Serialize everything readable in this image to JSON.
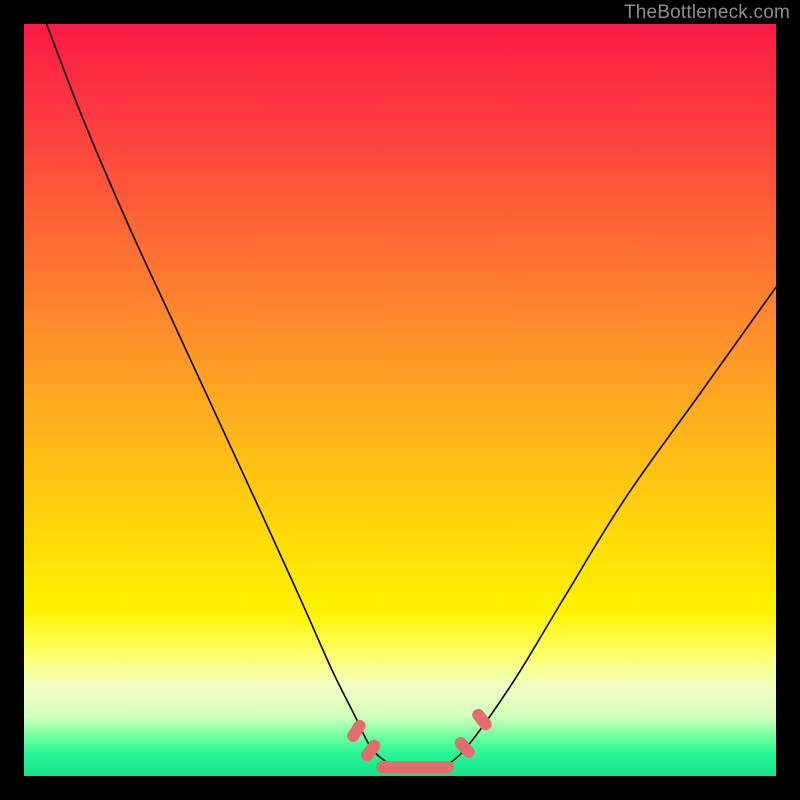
{
  "watermark": "TheBottleneck.com",
  "chart_data": {
    "type": "line",
    "title": "",
    "xlabel": "",
    "ylabel": "",
    "xlim": [
      0,
      100
    ],
    "ylim": [
      0,
      100
    ],
    "grid": false,
    "legend": false,
    "series": [
      {
        "name": "bottleneck-curve",
        "x": [
          3,
          8,
          14,
          20,
          26,
          32,
          37,
          41,
          44,
          46,
          48,
          50,
          53,
          55,
          57,
          59,
          62,
          66,
          72,
          80,
          90,
          100
        ],
        "y": [
          100,
          87,
          73,
          60,
          47,
          34,
          23,
          14,
          8,
          4,
          2,
          1,
          1,
          1,
          2,
          4,
          8,
          14,
          24,
          37,
          51,
          65
        ]
      }
    ],
    "markers": [
      {
        "shape": "capsule",
        "x": 44.2,
        "y": 6.0,
        "angle": -58
      },
      {
        "shape": "capsule",
        "x": 46.1,
        "y": 3.4,
        "angle": -52
      },
      {
        "shape": "capsule",
        "x": 58.6,
        "y": 3.8,
        "angle": 48
      },
      {
        "shape": "capsule",
        "x": 60.9,
        "y": 7.5,
        "angle": 52
      },
      {
        "shape": "bar",
        "x": 52.0,
        "y": 1.2,
        "width": 10.3
      }
    ],
    "background_gradient": {
      "direction": "top-to-bottom",
      "stops": [
        {
          "pos": 0.0,
          "color": "#fb1a45"
        },
        {
          "pos": 0.3,
          "color": "#fe6f33"
        },
        {
          "pos": 0.66,
          "color": "#ffd409"
        },
        {
          "pos": 0.84,
          "color": "#fcff6f"
        },
        {
          "pos": 0.95,
          "color": "#68ff9e"
        },
        {
          "pos": 1.0,
          "color": "#17e28c"
        }
      ]
    }
  }
}
